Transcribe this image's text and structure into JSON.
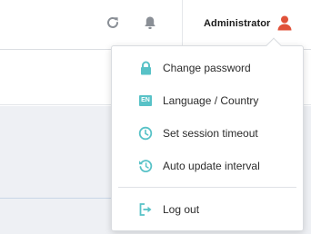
{
  "header": {
    "user_name": "Administrator",
    "icons": [
      "refresh-icon",
      "bell-icon",
      "user-icon"
    ],
    "user_icon_color": "#e0523a",
    "icon_color": "#8a8f96"
  },
  "user_menu": {
    "accent_color": "#58c2c7",
    "items": [
      {
        "label": "Change password",
        "icon": "lock-icon"
      },
      {
        "label": "Language / Country",
        "icon": "language-icon",
        "badge": "EN"
      },
      {
        "label": "Set session timeout",
        "icon": "clock-icon"
      },
      {
        "label": "Auto update interval",
        "icon": "auto-update-icon"
      },
      {
        "label": "Log out",
        "icon": "logout-icon"
      }
    ]
  }
}
